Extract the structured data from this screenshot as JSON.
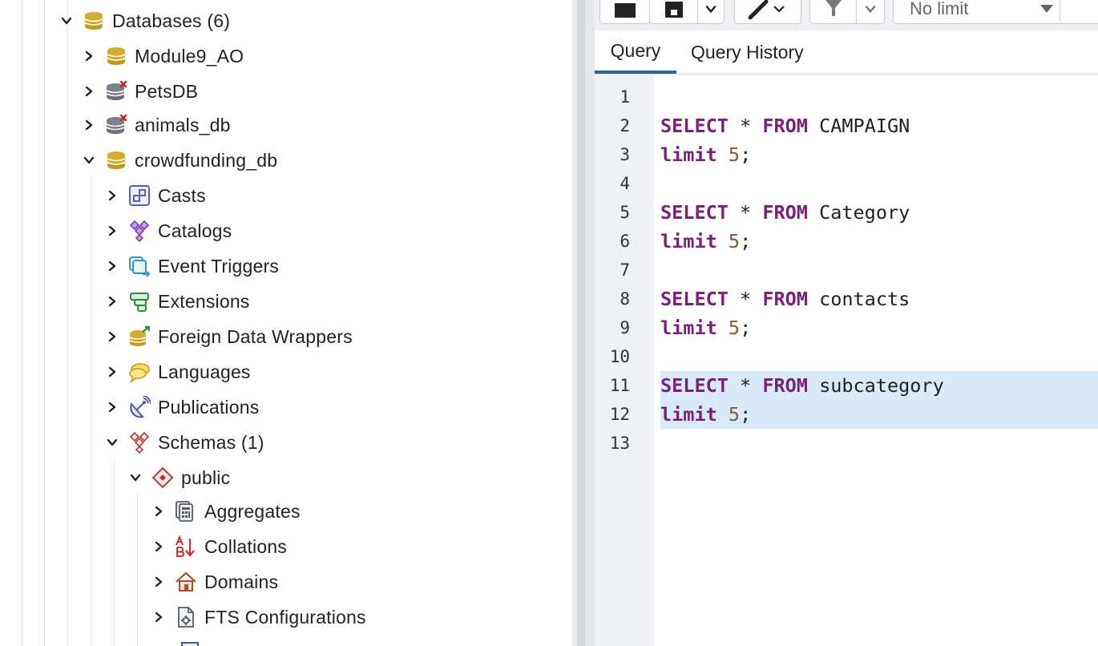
{
  "tree": {
    "databases": {
      "label": "Databases (6)",
      "expanded": true
    },
    "dbs": [
      {
        "label": "Module9_AO",
        "connected": true,
        "expanded": false
      },
      {
        "label": "PetsDB",
        "connected": false,
        "expanded": false
      },
      {
        "label": "animals_db",
        "connected": false,
        "expanded": false
      },
      {
        "label": "crowdfunding_db",
        "connected": true,
        "expanded": true
      }
    ],
    "db_children": [
      {
        "label": "Casts",
        "icon": "casts-icon"
      },
      {
        "label": "Catalogs",
        "icon": "catalogs-icon"
      },
      {
        "label": "Event Triggers",
        "icon": "event-triggers-icon"
      },
      {
        "label": "Extensions",
        "icon": "extensions-icon"
      },
      {
        "label": "Foreign Data Wrappers",
        "icon": "foreign-data-wrappers-icon"
      },
      {
        "label": "Languages",
        "icon": "languages-icon"
      },
      {
        "label": "Publications",
        "icon": "publications-icon"
      },
      {
        "label": "Schemas (1)",
        "icon": "schemas-icon",
        "expanded": true
      }
    ],
    "schema": {
      "label": "public"
    },
    "schema_children": [
      {
        "label": "Aggregates",
        "icon": "aggregates-icon"
      },
      {
        "label": "Collations",
        "icon": "collations-icon"
      },
      {
        "label": "Domains",
        "icon": "domains-icon"
      },
      {
        "label": "FTS Configurations",
        "icon": "fts-configurations-icon"
      }
    ]
  },
  "toolbar": {
    "limit_value": "No limit"
  },
  "tabs": [
    {
      "label": "Query",
      "active": true
    },
    {
      "label": "Query History",
      "active": false
    }
  ],
  "editor": {
    "line_numbers": [
      "1",
      "2",
      "3",
      "4",
      "5",
      "6",
      "7",
      "8",
      "9",
      "10",
      "11",
      "12",
      "13"
    ],
    "lines": [
      "",
      "SELECT * FROM CAMPAIGN",
      "limit 5;",
      "",
      "SELECT * FROM Category",
      "limit 5;",
      "",
      "SELECT * FROM contacts",
      "limit 5;",
      "",
      "SELECT * FROM subcategory",
      "limit 5;",
      ""
    ],
    "highlighted_lines": [
      11,
      12
    ]
  },
  "colors": {
    "keyword": "#7a1f7a",
    "number": "#7a5b3a",
    "selection": "#d9ebf8",
    "tab_accent": "#326690",
    "db_icon": "#c9a227",
    "disconnect_mark": "#c62828"
  }
}
